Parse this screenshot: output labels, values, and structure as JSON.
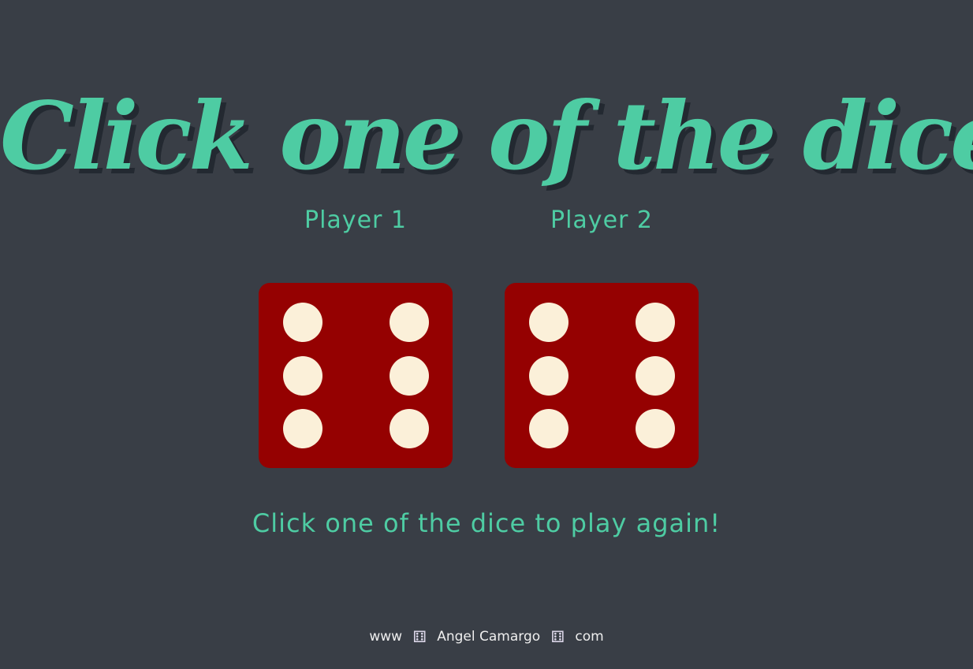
{
  "title": "Click one of the dice",
  "players": [
    {
      "label": "Player 1",
      "die_value": 6
    },
    {
      "label": "Player 2",
      "die_value": 6
    }
  ],
  "message": "Click one of the dice to play again!",
  "footer": {
    "prefix": "www",
    "name": "Angel Camargo",
    "suffix": "com",
    "icon": "dice-icon"
  },
  "colors": {
    "background": "#393e46",
    "accent": "#4ecca3",
    "die": "#950101",
    "pip": "#fbf0d9"
  }
}
